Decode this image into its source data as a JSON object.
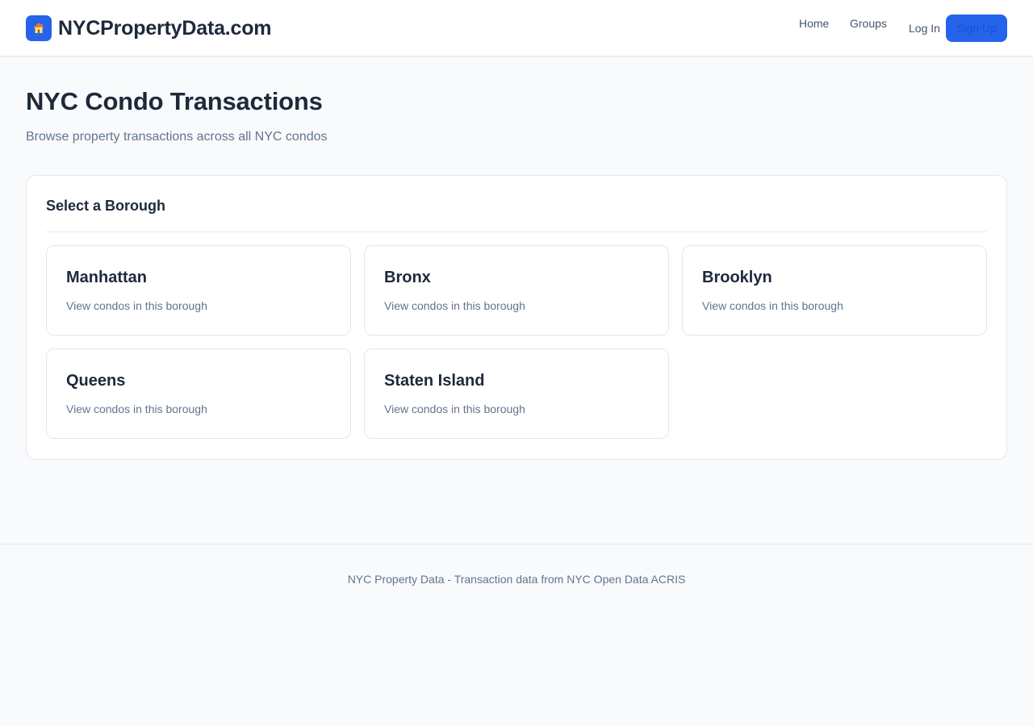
{
  "header": {
    "brand_name": "NYCPropertyData.com",
    "brand_icon": "house-icon",
    "nav": {
      "home": "Home",
      "groups": "Groups",
      "login": "Log In",
      "signup": "Sign Up"
    },
    "accent_color": "#2563eb"
  },
  "main": {
    "title": "NYC Condo Transactions",
    "subtitle": "Browse property transactions across all NYC condos",
    "borough_card": {
      "title": "Select a Borough",
      "boroughs": [
        {
          "name": "Manhattan",
          "description": "View condos in this borough"
        },
        {
          "name": "Bronx",
          "description": "View condos in this borough"
        },
        {
          "name": "Brooklyn",
          "description": "View condos in this borough"
        },
        {
          "name": "Queens",
          "description": "View condos in this borough"
        },
        {
          "name": "Staten Island",
          "description": "View condos in this borough"
        }
      ]
    }
  },
  "footer": {
    "text": "NYC Property Data - Transaction data from NYC Open Data ACRIS"
  }
}
